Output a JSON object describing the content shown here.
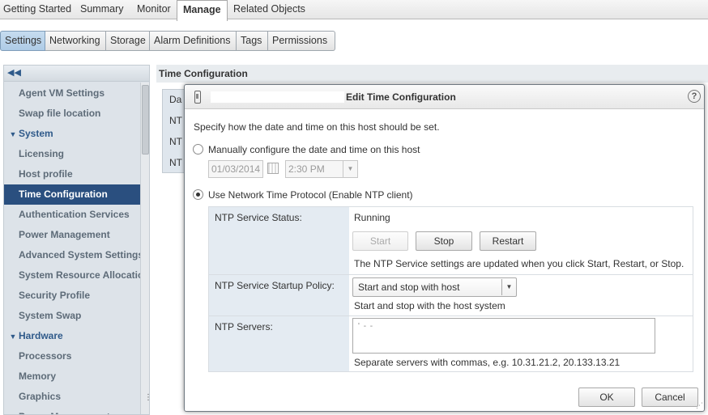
{
  "top_tabs": [
    "Getting Started",
    "Summary",
    "Monitor",
    "Manage",
    "Related Objects"
  ],
  "active_top_tab": "Manage",
  "sub_tabs": [
    "Settings",
    "Networking",
    "Storage",
    "Alarm Definitions",
    "Tags",
    "Permissions"
  ],
  "active_sub_tab": "Settings",
  "sidebar": {
    "items": [
      {
        "label": "Agent VM Settings"
      },
      {
        "label": "Swap file location"
      },
      {
        "label": "System",
        "section": true
      },
      {
        "label": "Licensing"
      },
      {
        "label": "Host profile"
      },
      {
        "label": "Time Configuration",
        "selected": true
      },
      {
        "label": "Authentication Services"
      },
      {
        "label": "Power Management"
      },
      {
        "label": "Advanced System Settings"
      },
      {
        "label": "System Resource Allocation"
      },
      {
        "label": "Security Profile"
      },
      {
        "label": "System Swap"
      },
      {
        "label": "Hardware",
        "section": true
      },
      {
        "label": "Processors"
      },
      {
        "label": "Memory"
      },
      {
        "label": "Graphics"
      },
      {
        "label": "Power Management"
      }
    ]
  },
  "main": {
    "title": "Time Configuration",
    "bg_rows": [
      "Da",
      "NT",
      "NT",
      "NT"
    ]
  },
  "dialog": {
    "title": "Edit Time Configuration",
    "help": "?",
    "intro": "Specify how the date and time on this host should be set.",
    "manual_option": "Manually configure the date and time on this host",
    "manual_selected": false,
    "date_value": "01/03/2014",
    "time_value": "2:30 PM",
    "ntp_option": "Use Network Time Protocol (Enable NTP client)",
    "ntp_selected": true,
    "service_status_label": "NTP Service Status:",
    "service_status_value": "Running",
    "start_label": "Start",
    "stop_label": "Stop",
    "restart_label": "Restart",
    "service_note": "The NTP Service settings are updated when you click Start, Restart, or Stop.",
    "startup_policy_label": "NTP Service Startup Policy:",
    "startup_policy_value": "Start and stop with host",
    "startup_policy_note": "Start and stop with the host system",
    "servers_label": "NTP Servers:",
    "servers_hint": "Separate servers with commas, e.g. 10.31.21.2, 20.133.13.21",
    "ok_label": "OK",
    "cancel_label": "Cancel"
  },
  "colors": {
    "selected_item_bg": "#2a4f7f",
    "section_text": "#2f5a8a",
    "label_column_bg": "#e4ebf2"
  }
}
